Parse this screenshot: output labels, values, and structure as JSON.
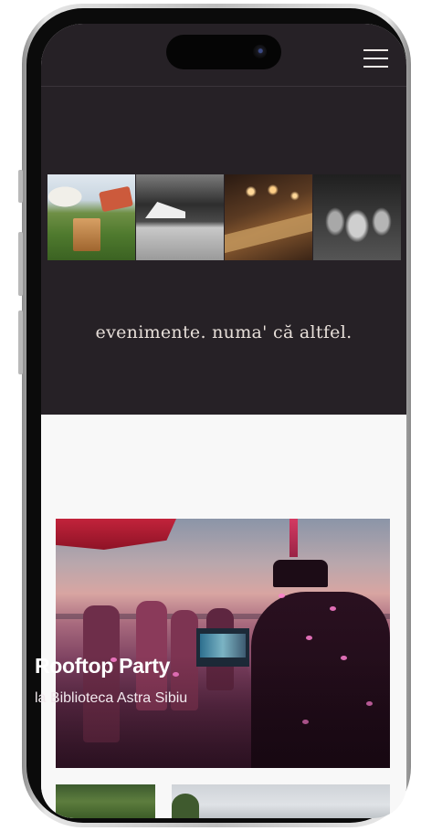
{
  "header": {
    "menu_icon": "hamburger-menu-icon"
  },
  "hero": {
    "photos": [
      {
        "name": "garden-event-photo"
      },
      {
        "name": "forest-tent-photo"
      },
      {
        "name": "dinner-table-photo"
      },
      {
        "name": "party-crowd-photo"
      }
    ],
    "tagline": "evenimente. numa' că altfel."
  },
  "events": {
    "featured": {
      "title": "Rooftop Party",
      "subtitle": "la Biblioteca Astra Sibiu"
    }
  },
  "colors": {
    "dark_background": "#262126",
    "light_background": "#f8f8f8",
    "tagline_text": "#e7dfd9",
    "accent_pink": "#ff7fd0"
  }
}
